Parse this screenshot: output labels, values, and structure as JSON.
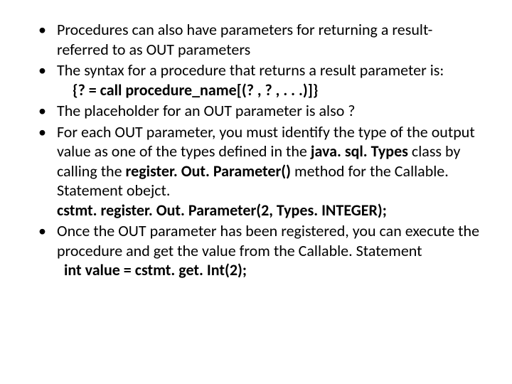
{
  "bullets": {
    "b1": "Procedures can also have parameters for returning a result- referred to as OUT parameters",
    "b2": "The syntax for a procedure that returns a result parameter is:",
    "b2_code": "{? = call procedure_name[(? , ? , . . .)]}",
    "b3": "The placeholder for an OUT parameter is also ?",
    "b4a": "For each OUT parameter, you must identify the type of the output value as one of the types defined in the ",
    "b4_bold1": "java. sql. Types",
    "b4b": " class by calling the ",
    "b4_bold2": "register. Out. Parameter()",
    "b4c": " method for the Callable. Statement obejct.",
    "b4_code": "cstmt. register. Out. Parameter(2, Types. INTEGER);",
    "b5": "Once the OUT parameter has been registered, you can execute the procedure and get the value from the Callable. Statement",
    "b5_code": "int value = cstmt. get. Int(2);"
  }
}
